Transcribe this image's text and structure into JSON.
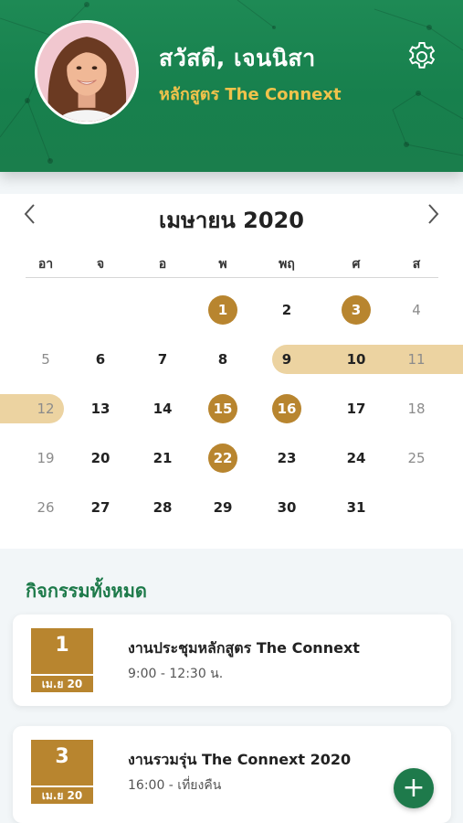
{
  "header": {
    "greeting": "สวัสดี, เจนนิสา",
    "course": "หลักสูตร The Connext",
    "settings_icon": "gear-icon",
    "colors": {
      "background": "#1a834f",
      "accent": "#f0c24b"
    }
  },
  "calendar": {
    "month_label": "เมษายน 2020",
    "prev_icon": "chevron-left-icon",
    "next_icon": "chevron-right-icon",
    "weekdays": [
      "อา",
      "จ",
      "อ",
      "พ",
      "พฤ",
      "ศ",
      "ส"
    ],
    "weeks": [
      [
        "",
        "",
        "",
        "1",
        "2",
        "3",
        "4"
      ],
      [
        "5",
        "6",
        "7",
        "8",
        "9",
        "10",
        "11"
      ],
      [
        "12",
        "13",
        "14",
        "15",
        "16",
        "17",
        "18"
      ],
      [
        "19",
        "20",
        "21",
        "22",
        "23",
        "24",
        "25"
      ],
      [
        "26",
        "27",
        "28",
        "29",
        "30",
        "31",
        ""
      ]
    ],
    "event_days": [
      "1",
      "3",
      "15",
      "16",
      "22"
    ],
    "range_days": [
      "9",
      "10",
      "11",
      "12"
    ],
    "colors": {
      "event": "#b8852f",
      "range": "#ecd3a1"
    }
  },
  "activities": {
    "title": "กิจกรรมทั้งหมด",
    "items": [
      {
        "day": "1",
        "month": "เม.ย 20",
        "title": "งานประชุมหลักสูตร The Connext",
        "time": "9:00 - 12:30 น."
      },
      {
        "day": "3",
        "month": "เม.ย 20",
        "title": "งานรวมรุ่น The Connext 2020",
        "time": "16:00 - เที่ยงคืน"
      }
    ]
  },
  "fab": {
    "label": "+",
    "icon": "plus-icon"
  }
}
